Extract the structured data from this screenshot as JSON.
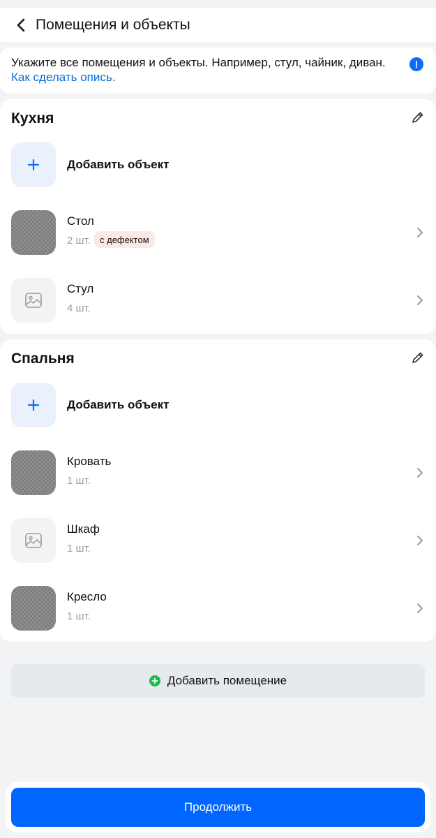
{
  "header": {
    "title": "Помещения и объекты"
  },
  "info": {
    "text": "Укажите все помещения и объекты. Например, стул, чайник, диван.",
    "link": "Как сделать опись.",
    "icon": "exclamation-icon"
  },
  "rooms": [
    {
      "title": "Кухня",
      "add_label": "Добавить объект",
      "items": [
        {
          "name": "Стол",
          "qty": "2 шт.",
          "badge": "с дефектом",
          "thumb": "photo"
        },
        {
          "name": "Стул",
          "qty": "4 шт.",
          "thumb": "placeholder"
        }
      ]
    },
    {
      "title": "Спальня",
      "add_label": "Добавить объект",
      "items": [
        {
          "name": "Кровать",
          "qty": "1 шт.",
          "thumb": "photo"
        },
        {
          "name": "Шкаф",
          "qty": "1 шт.",
          "thumb": "placeholder"
        },
        {
          "name": "Кресло",
          "qty": "1 шт.",
          "thumb": "photo"
        }
      ]
    }
  ],
  "add_room_label": "Добавить помещение",
  "continue_label": "Продолжить",
  "colors": {
    "accent": "#0066ff",
    "link": "#0a6ed6",
    "add_room_icon": "#1fba4e",
    "defect_badge": "#fde8e8"
  }
}
